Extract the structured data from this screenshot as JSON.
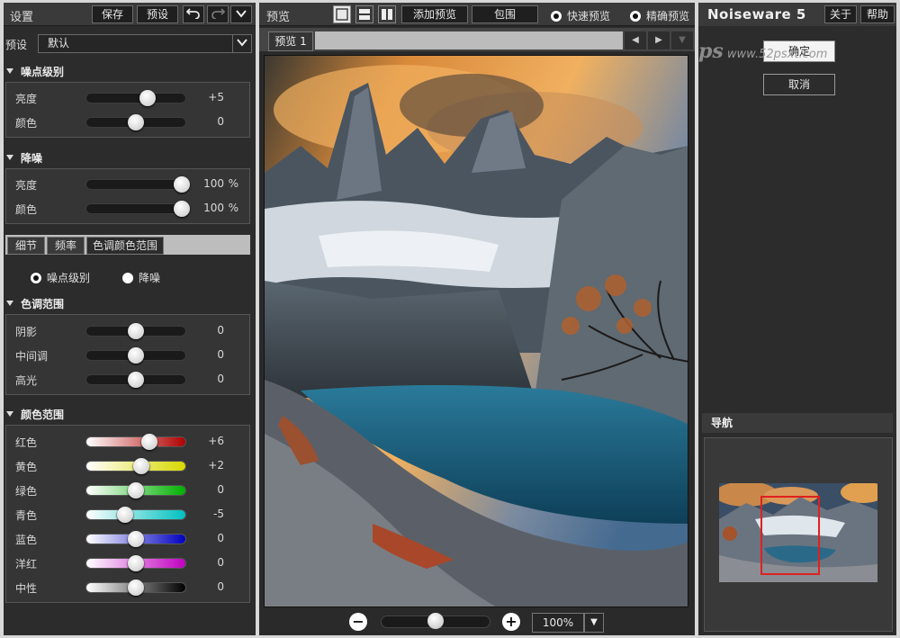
{
  "left": {
    "title": "设置",
    "buttons": {
      "save": "保存",
      "preset": "预设"
    },
    "preset_label": "预设",
    "preset_value": "默认",
    "noise_level": {
      "header": "噪点级别",
      "rows": [
        {
          "label": "亮度",
          "value": "+5",
          "pos": 0.62
        },
        {
          "label": "颜色",
          "value": "0",
          "pos": 0.5
        }
      ]
    },
    "reduction": {
      "header": "降噪",
      "rows": [
        {
          "label": "亮度",
          "value": "100",
          "unit": "%",
          "pos": 0.96
        },
        {
          "label": "颜色",
          "value": "100",
          "unit": "%",
          "pos": 0.96
        }
      ]
    },
    "tabs": [
      "细节",
      "频率",
      "色调颜色范围"
    ],
    "radios": {
      "noise_level": "噪点级别",
      "reduction": "降噪"
    },
    "tone_range": {
      "header": "色调范围",
      "rows": [
        {
          "label": "阴影",
          "value": "0",
          "pos": 0.5
        },
        {
          "label": "中间调",
          "value": "0",
          "pos": 0.5
        },
        {
          "label": "高光",
          "value": "0",
          "pos": 0.5
        }
      ]
    },
    "color_range": {
      "header": "颜色范围",
      "rows": [
        {
          "label": "红色",
          "value": "+6",
          "pos": 0.64,
          "color": "#b00000"
        },
        {
          "label": "黄色",
          "value": "+2",
          "pos": 0.55,
          "color": "#d8d800"
        },
        {
          "label": "绿色",
          "value": "0",
          "pos": 0.5,
          "color": "#00b000"
        },
        {
          "label": "青色",
          "value": "-5",
          "pos": 0.39,
          "color": "#00c0c0"
        },
        {
          "label": "蓝色",
          "value": "0",
          "pos": 0.5,
          "color": "#0000c0"
        },
        {
          "label": "洋红",
          "value": "0",
          "pos": 0.5,
          "color": "#c000c0"
        },
        {
          "label": "中性",
          "value": "0",
          "pos": 0.5,
          "color": "#000000"
        }
      ]
    }
  },
  "center": {
    "title": "预览",
    "add_preview": "添加预览",
    "envelope": "包围",
    "fast_preview": "快速预览",
    "accurate_preview": "精确预览",
    "tab": "预览 1",
    "zoom": "100%",
    "zoom_pos": 0.5
  },
  "right": {
    "logo": "Noiseware 5",
    "about": "关于",
    "help": "帮助",
    "ok": "确定",
    "cancel": "取消",
    "watermark": "www.52psxt.com",
    "navigator": "导航"
  }
}
